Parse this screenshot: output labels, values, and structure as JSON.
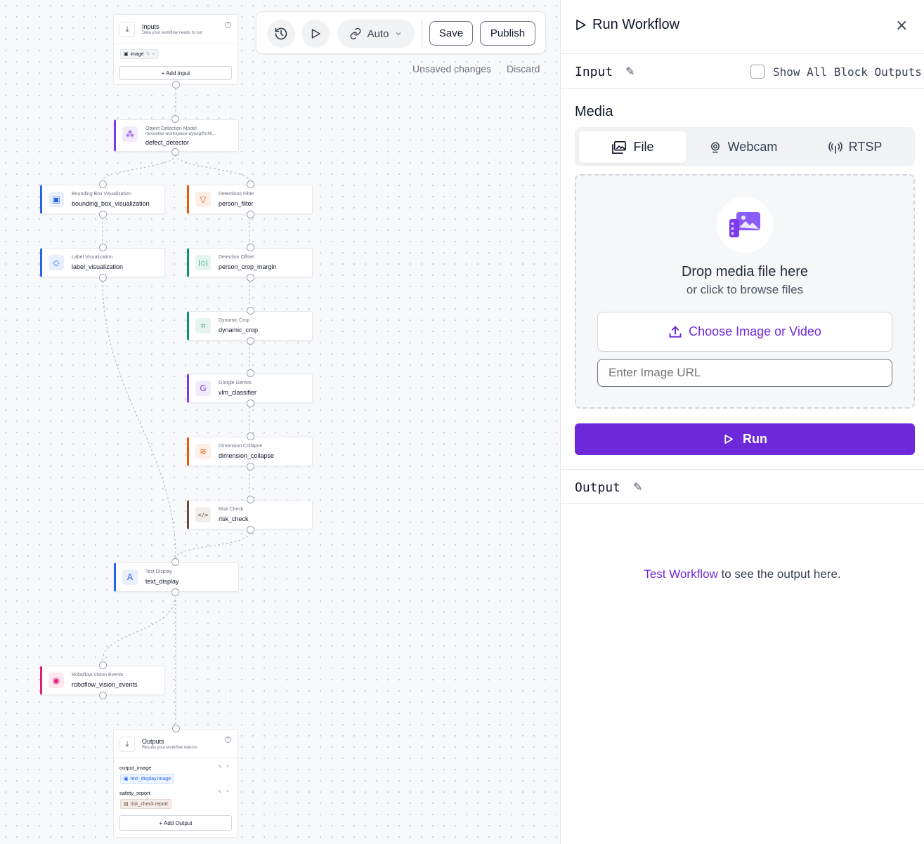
{
  "toolbar": {
    "icons": [
      "history-icon",
      "play-icon",
      "link-icon"
    ],
    "auto_label": "Auto",
    "save_label": "Save",
    "publish_label": "Publish",
    "unsaved_text": "Unsaved changes",
    "discard_label": "Discard"
  },
  "canvas": {
    "inputs": {
      "title": "Inputs",
      "description": "Data your workflow needs to run",
      "chip": "image",
      "add_label": "+ Add Input"
    },
    "blocks": [
      {
        "id": "defect_detector",
        "kind": "Object Detection Model",
        "sub": "mostafas-workspace-dyuzg/forkli...",
        "name": "defect_detector",
        "icon": "model-network-icon",
        "accent": "#7c3aed"
      },
      {
        "id": "bbox",
        "kind": "Bounding Box Visualization",
        "name": "bounding_box_visualization",
        "icon": "bounding-box-icon",
        "accent": "#2563eb"
      },
      {
        "id": "person_filter",
        "kind": "Detections Filter",
        "name": "person_filter",
        "icon": "filter-icon",
        "accent": "#ea580c"
      },
      {
        "id": "label_vis",
        "kind": "Label Visualization",
        "name": "label_visualization",
        "icon": "tag-icon",
        "accent": "#2563eb"
      },
      {
        "id": "crop_margin",
        "kind": "Detection Offset",
        "name": "person_crop_margin",
        "icon": "offset-icon",
        "accent": "#059669"
      },
      {
        "id": "dynamic_crop",
        "kind": "Dynamic Crop",
        "name": "dynamic_crop",
        "icon": "crop-icon",
        "accent": "#059669"
      },
      {
        "id": "vlm",
        "kind": "Google Gemini",
        "name": "vlm_classifier",
        "icon": "gemini-g-icon",
        "accent": "#7c3aed"
      },
      {
        "id": "collapse",
        "kind": "Dimension Collapse",
        "name": "dimension_collapse",
        "icon": "layers-icon",
        "accent": "#ea580c"
      },
      {
        "id": "risk",
        "kind": "Risk Check",
        "name": "risk_check",
        "icon": "code-icon",
        "accent": "#6b4a3a"
      },
      {
        "id": "text_display",
        "kind": "Text Display",
        "name": "text_display",
        "icon": "text-icon",
        "accent": "#2563eb"
      },
      {
        "id": "events",
        "kind": "Roboflow Vision Events",
        "name": "roboflow_vision_events",
        "icon": "eye-icon",
        "accent": "#e11d74"
      }
    ],
    "outputs": {
      "title": "Outputs",
      "description": "Results your workflow returns",
      "items": [
        {
          "name": "output_image",
          "chip": "text_display.image"
        },
        {
          "name": "safety_report",
          "chip": "risk_check.report"
        }
      ],
      "add_label": "+ Add Output"
    }
  },
  "panel": {
    "title": "Run Workflow",
    "input_label": "Input",
    "show_all_label": "Show All Block Outputs",
    "show_all_checked": false,
    "media_label": "Media",
    "tabs": [
      {
        "label": "File",
        "icon": "images-icon",
        "active": true
      },
      {
        "label": "Webcam",
        "icon": "webcam-icon",
        "active": false
      },
      {
        "label": "RTSP",
        "icon": "antenna-icon",
        "active": false
      }
    ],
    "drop_title": "Drop media file here",
    "drop_sub": "or click to browse files",
    "choose_label": "Choose Image or Video",
    "url_placeholder": "Enter Image URL",
    "run_label": "Run",
    "output_label": "Output",
    "output_link": "Test Workflow",
    "output_rest": " to see the output here.",
    "colors": {
      "primary": "#6d28d9",
      "link": "#6d28d9"
    }
  }
}
